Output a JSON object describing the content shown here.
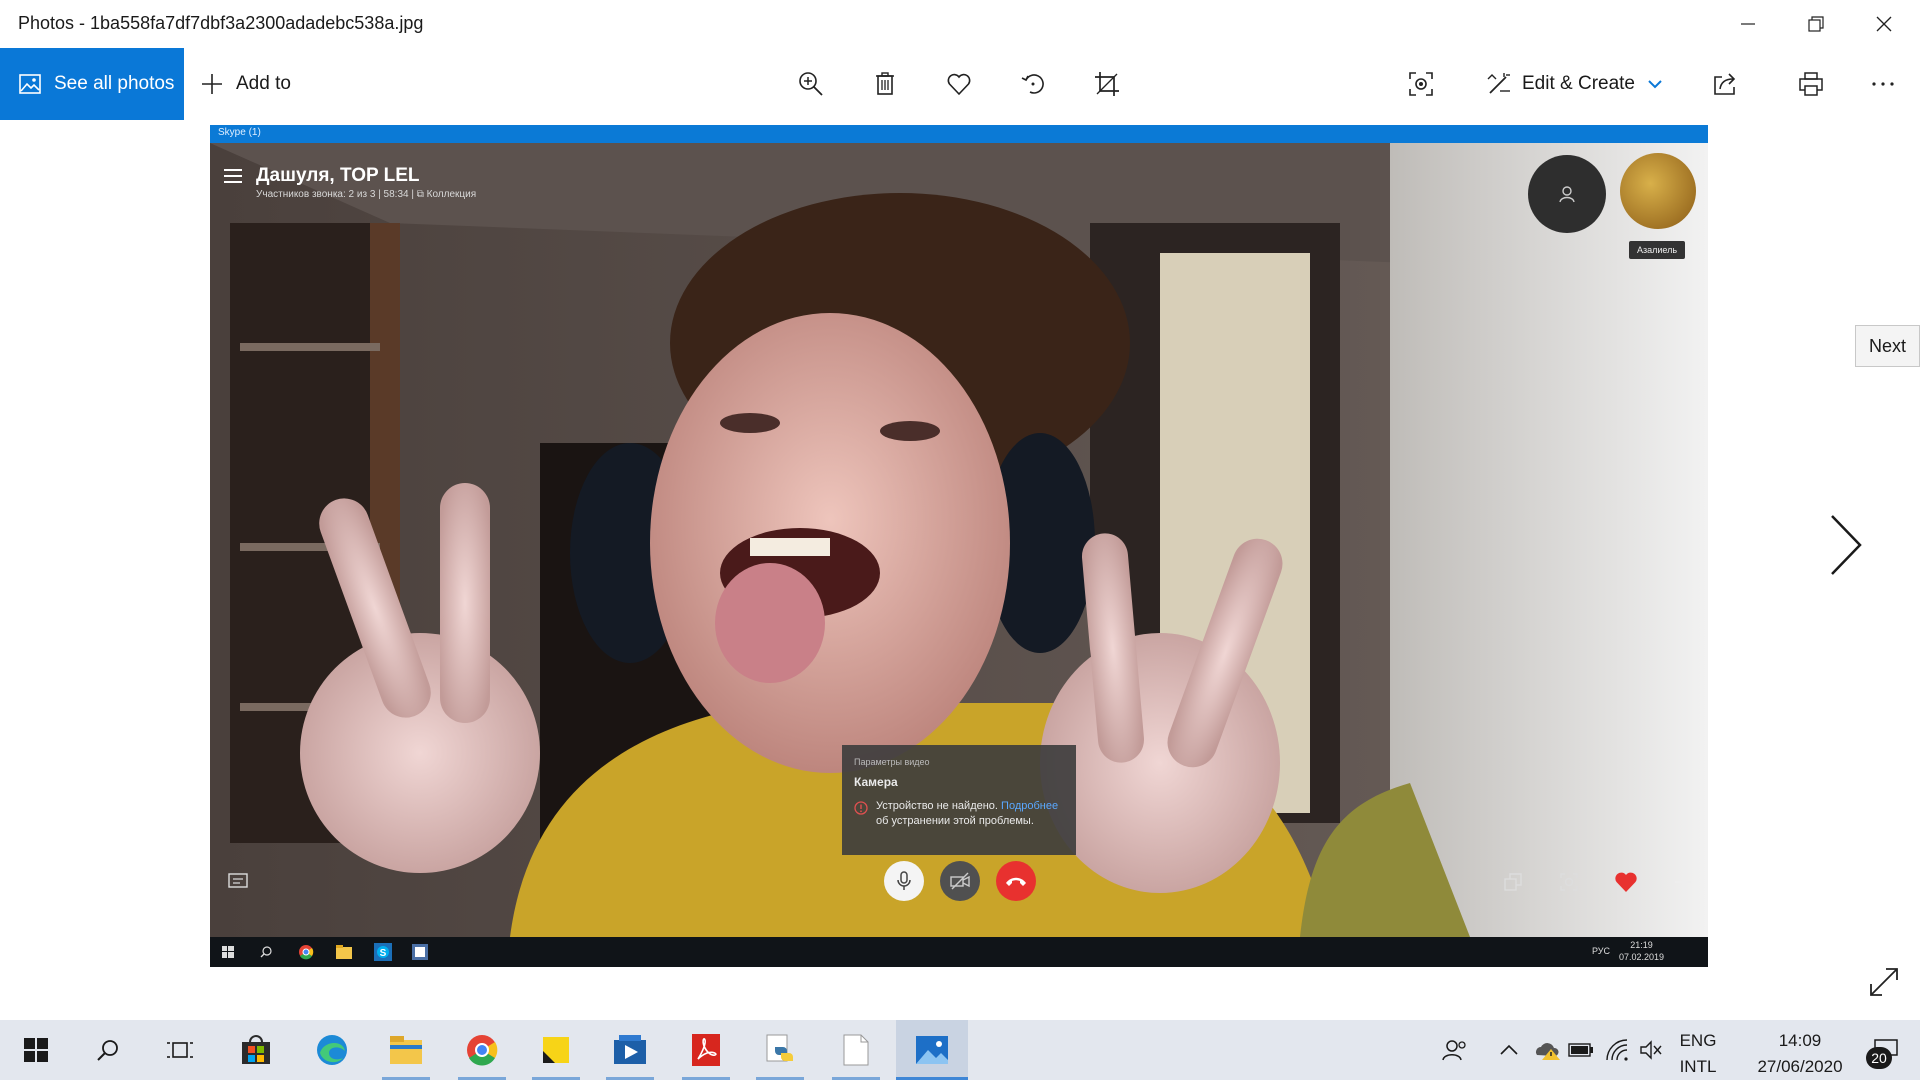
{
  "window": {
    "title": "Photos - 1ba558fa7df7dbf3a2300adadebc538a.jpg",
    "controls": [
      "minimize-icon",
      "restore-icon",
      "close-icon"
    ]
  },
  "commandbar": {
    "see_all": "See all photos",
    "add_to": "Add to",
    "edit_create": "Edit & Create",
    "tools": [
      "zoom-in-icon",
      "delete-icon",
      "favorite-icon",
      "rotate-icon",
      "crop-icon"
    ],
    "right_tools": [
      "enhance-icon",
      "share-icon",
      "print-icon",
      "more-icon"
    ],
    "accent": "#0a78d7"
  },
  "photo": {
    "skype_window_title": "Skype (1)",
    "call": {
      "title": "Дашуля, TOP LEL",
      "subtitle": "Участников звонка: 2 из 3 | 58:34 | ⧉ Коллекция"
    },
    "popup": {
      "header": "Параметры видео",
      "title": "Камера",
      "message_prefix": "Устройство не найдено.",
      "message_link": "Подробнее",
      "message_suffix": "об устранении этой проблемы."
    },
    "participant_name": "Азалиель",
    "inner_taskbar": {
      "lang": "РУС",
      "time": "21:19",
      "date": "07.02.2019"
    }
  },
  "navigation": {
    "next_tooltip": "Next"
  },
  "taskbar": {
    "apps": [
      "windows-start-icon",
      "search-icon",
      "task-view-icon",
      "store-icon",
      "edge-icon",
      "file-explorer-icon",
      "chrome-icon",
      "sticky-notes-icon",
      "media-player-icon",
      "acrobat-icon",
      "python-icon",
      "notepad-icon",
      "photos-icon"
    ],
    "tray_lang_1": "ENG",
    "tray_lang_2": "INTL",
    "time": "14:09",
    "date": "27/06/2020",
    "notifications": "20"
  }
}
